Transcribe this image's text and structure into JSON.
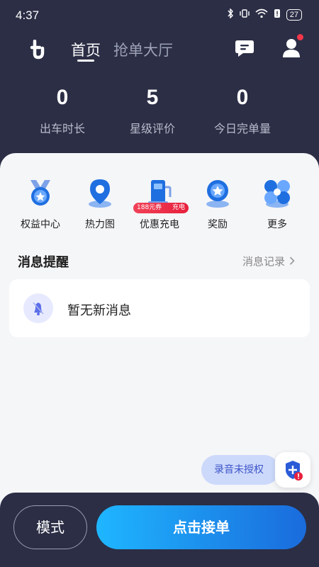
{
  "status_bar": {
    "time": "4:37",
    "battery": "27"
  },
  "header": {
    "tabs": [
      {
        "label": "首页",
        "active": true
      },
      {
        "label": "抢单大厅",
        "active": false
      }
    ]
  },
  "stats": [
    {
      "value": "0",
      "label": "出车时长"
    },
    {
      "value": "5",
      "label": "星级评价"
    },
    {
      "value": "0",
      "label": "今日完单量"
    }
  ],
  "shortcuts": [
    {
      "label": "权益中心",
      "icon": "badge-star-icon"
    },
    {
      "label": "热力图",
      "icon": "map-pin-icon"
    },
    {
      "label": "优惠充电",
      "icon": "charging-pile-icon"
    },
    {
      "label": "奖励",
      "icon": "reward-medal-icon"
    },
    {
      "label": "更多",
      "icon": "more-apps-icon"
    }
  ],
  "promo": {
    "coupon": "188元券",
    "tag": "充电"
  },
  "notifications": {
    "title": "消息提醒",
    "link": "消息记录",
    "empty_text": "暂无新消息"
  },
  "recording": {
    "label": "录音未授权"
  },
  "bottom": {
    "mode_label": "模式",
    "accept_label": "点击接单"
  },
  "colors": {
    "header_bg": "#2b2e45",
    "accent_blue": "#1a6bdc",
    "badge_red": "#f2364b"
  }
}
